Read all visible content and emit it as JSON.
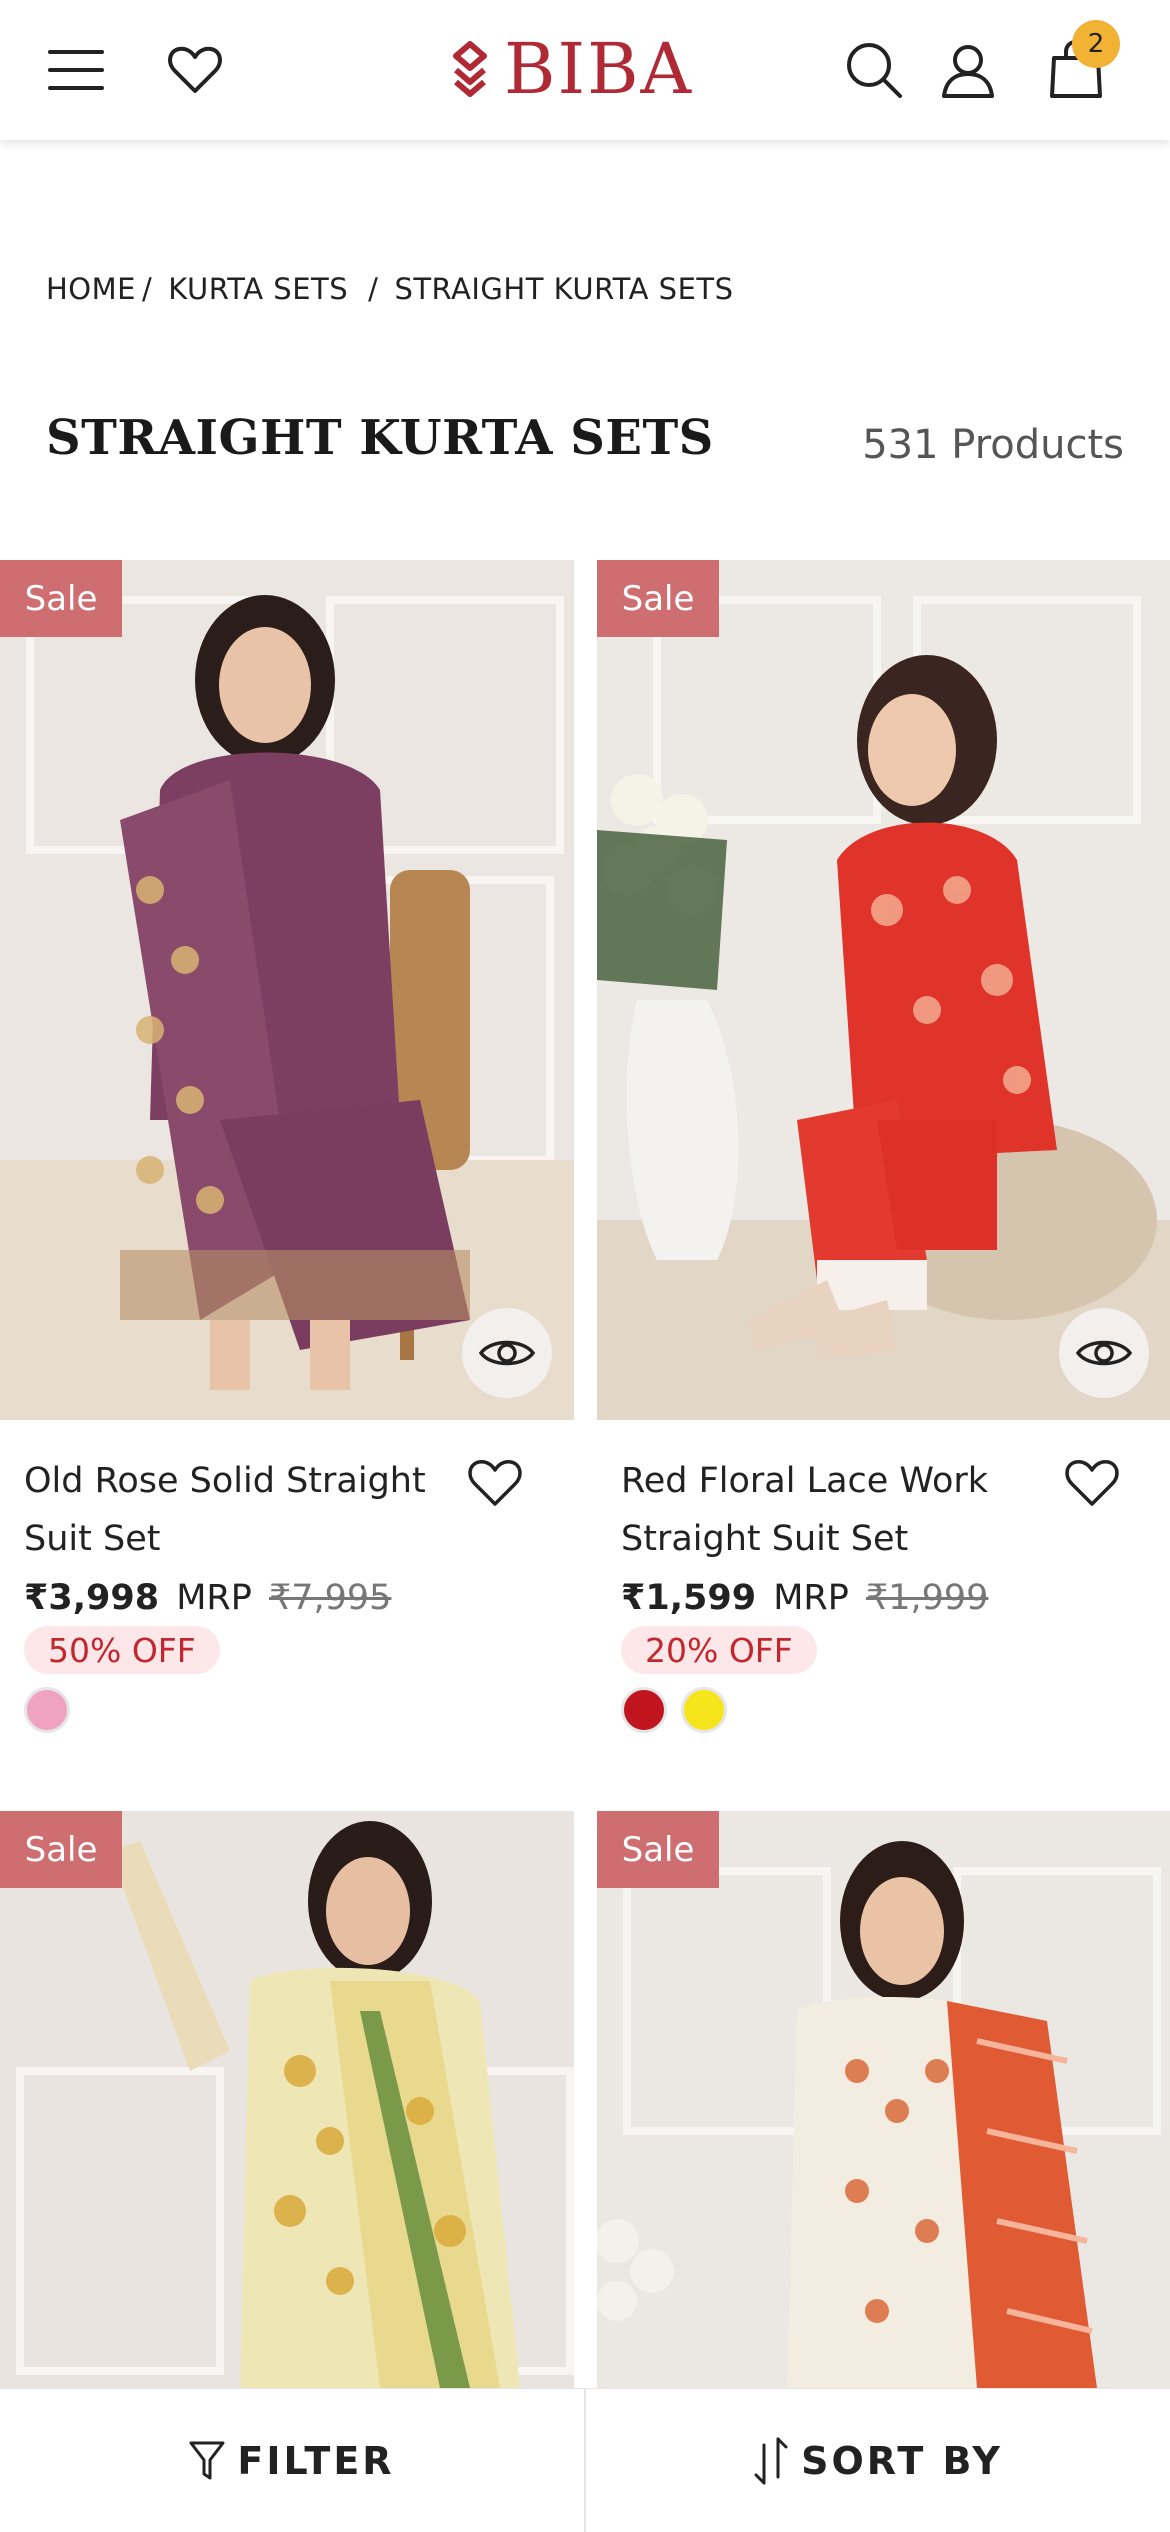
{
  "header": {
    "menu_icon": "hamburger-menu-icon",
    "wishlist_icon": "heart-icon",
    "brand": "BIBA",
    "brand_color": "#b02a36",
    "search_icon": "search-icon",
    "account_icon": "user-icon",
    "cart_icon": "shopping-bag-icon",
    "cart_count": "2"
  },
  "breadcrumb": {
    "items": [
      "HOME",
      "KURTA SETS",
      "STRAIGHT KURTA SETS"
    ],
    "separators": [
      "/",
      "/"
    ]
  },
  "listing": {
    "title": "STRAIGHT KURTA SETS",
    "count": "531 Products"
  },
  "products": [
    {
      "badge": "Sale",
      "name": "Old Rose Solid Straight Suit Set",
      "price": "₹3,998",
      "mrp_label": "MRP",
      "mrp": "₹7,995",
      "discount": "50% OFF",
      "swatches": [
        "#f0a2c1"
      ]
    },
    {
      "badge": "Sale",
      "name": "Red Floral Lace Work Straight Suit Set",
      "price": "₹1,599",
      "mrp_label": "MRP",
      "mrp": "₹1,999",
      "discount": "20% OFF",
      "swatches": [
        "#c0141f",
        "#f7e51c"
      ]
    },
    {
      "badge": "Sale"
    },
    {
      "badge": "Sale"
    }
  ],
  "bottom_bar": {
    "filter_label": "FILTER",
    "sort_label": "SORT BY"
  },
  "colors": {
    "sale_badge": "#cf6e70",
    "discount_bg": "#fde7e8",
    "discount_text": "#c1272d",
    "cart_badge": "#f2b233"
  }
}
